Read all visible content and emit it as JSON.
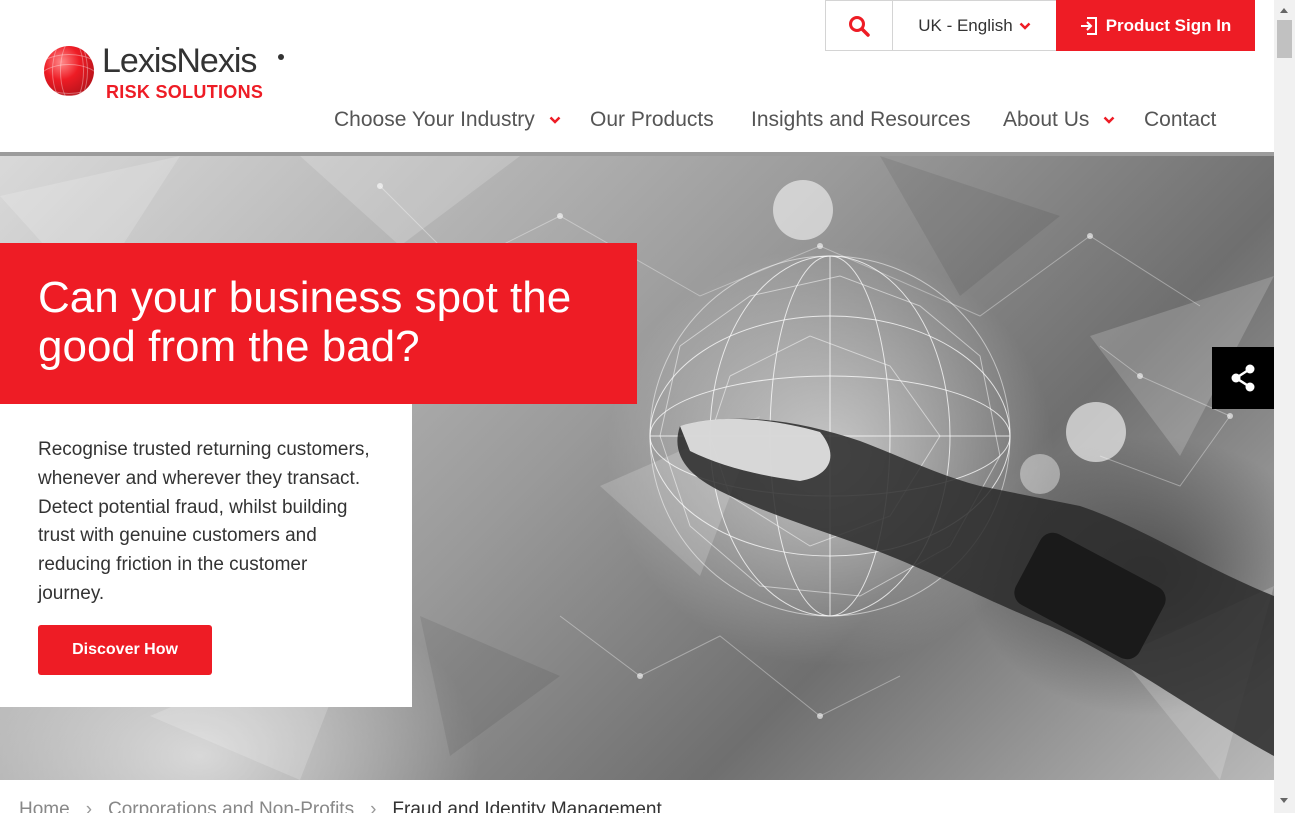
{
  "brand": {
    "name": "LexisNexis",
    "tagline": "RISK SOLUTIONS",
    "accent_color": "#ee1c25"
  },
  "utility": {
    "search_icon": "search-icon",
    "language_label": "UK - English",
    "signin_icon": "sign-in-icon",
    "signin_label": "Product Sign In"
  },
  "nav": {
    "items": [
      {
        "label": "Choose Your Industry",
        "has_dropdown": true
      },
      {
        "label": "Our Products",
        "has_dropdown": false
      },
      {
        "label": "Insights and Resources",
        "has_dropdown": false
      },
      {
        "label": "About Us",
        "has_dropdown": true
      },
      {
        "label": "Contact",
        "has_dropdown": false
      }
    ]
  },
  "hero": {
    "headline": "Can your business spot the good from the bad?",
    "description": "Recognise trusted returning customers, whenever and wherever they transact. Detect potential fraud, whilst building trust with genuine customers and reducing friction in the customer journey.",
    "cta_label": "Discover How",
    "share_icon": "share-icon"
  },
  "breadcrumb": {
    "items": [
      "Home",
      "Corporations and Non-Profits",
      "Fraud and Identity Management"
    ],
    "separator": "›"
  }
}
